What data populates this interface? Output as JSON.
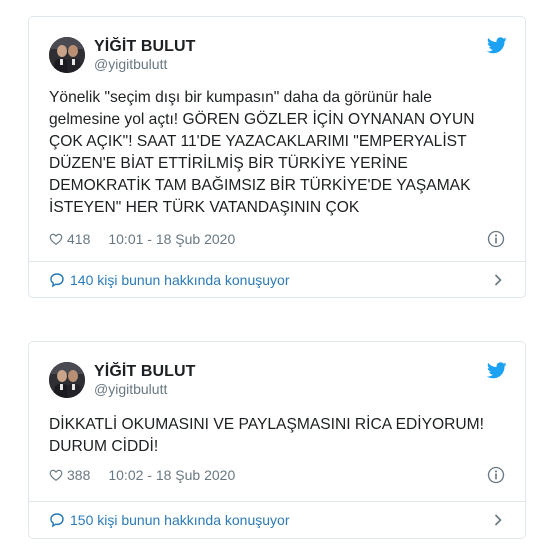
{
  "tweets": [
    {
      "author": {
        "name": "YİĞİT BULUT",
        "handle": "@yigitbulutt"
      },
      "text": "Yönelik \"seçim dışı bir kumpasın\" daha da görünür hale gelmesine yol açtı! GÖREN GÖZLER İÇİN OYNANAN OYUN ÇOK AÇIK\"! SAAT 11'DE YAZACAKLARIMI \"EMPERYALİST DÜZEN'E BİAT ETTİRİLMİŞ BİR TÜRKİYE YERİNE DEMOKRATİK TAM BAĞIMSIZ BİR TÜRKİYE'DE YAŞAMAK İSTEYEN\" HER TÜRK VATANDAŞININ ÇOK",
      "likes": "418",
      "timestamp": "10:01 - 18 Şub 2020",
      "conversation": "140 kişi bunun hakkında konuşuyor"
    },
    {
      "author": {
        "name": "YİĞİT BULUT",
        "handle": "@yigitbulutt"
      },
      "text": "DİKKATLİ OKUMASINI VE PAYLAŞMASINI RİCA EDİYORUM! DURUM CİDDİ!",
      "likes": "388",
      "timestamp": "10:02 - 18 Şub 2020",
      "conversation": "150 kişi bunun hakkında konuşuyor"
    }
  ],
  "icons": {
    "brand": "twitter-bird-icon",
    "like": "heart-outline-icon",
    "info": "info-circle-icon",
    "conversation": "speech-bubble-icon",
    "more": "chevron-right-icon"
  },
  "colors": {
    "twitter_blue": "#1da1f2",
    "link_blue": "#2b7bb9",
    "secondary_text": "#697882",
    "border": "#e1e8ed",
    "body_text": "#1c2022"
  }
}
